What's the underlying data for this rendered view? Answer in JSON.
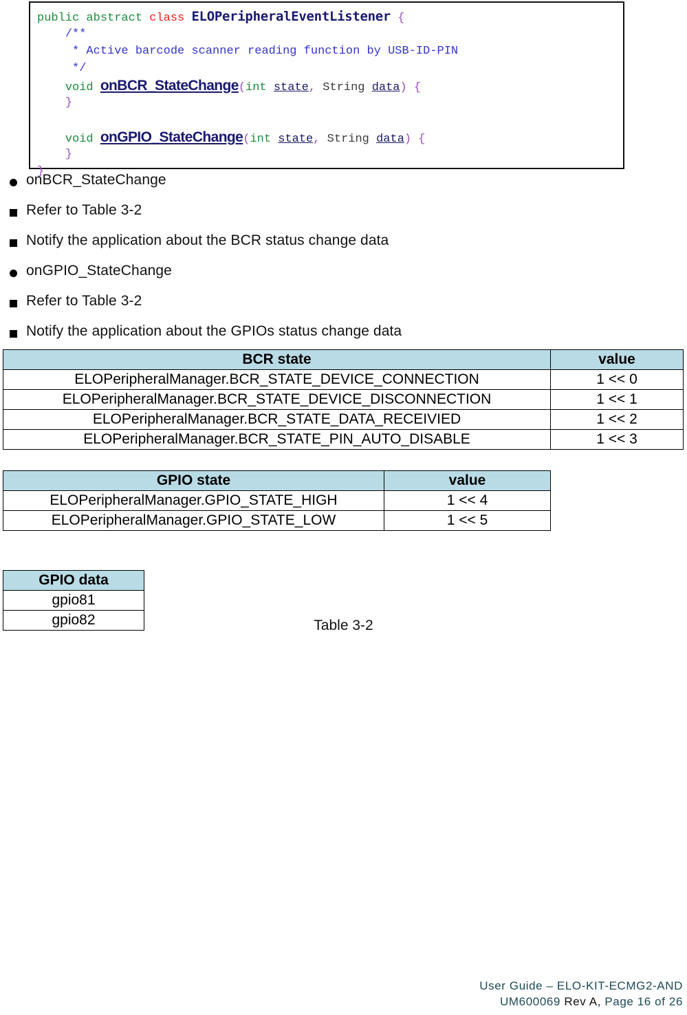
{
  "code_block": {
    "language": "java",
    "lines": [
      {
        "indent": 0,
        "tokens": [
          {
            "t": "public abstract ",
            "c": "kw-green"
          },
          {
            "t": "class ",
            "c": "kw-red"
          },
          {
            "t": "ELOPeripheralEventListener",
            "c": "cls-name"
          },
          {
            "t": " {",
            "c": "brace"
          }
        ]
      },
      {
        "indent": 1,
        "tokens": [
          {
            "t": "/**",
            "c": "cmt"
          }
        ]
      },
      {
        "indent": 1,
        "tokens": [
          {
            "t": " * Active barcode scanner reading function by USB-ID-PIN",
            "c": "cmt"
          }
        ]
      },
      {
        "indent": 1,
        "tokens": [
          {
            "t": " */",
            "c": "cmt"
          }
        ]
      },
      {
        "indent": 1,
        "tokens": [
          {
            "t": "void ",
            "c": "kw-green"
          },
          {
            "t": "onBCR_StateChange",
            "c": "method"
          },
          {
            "t": "(",
            "c": "paren"
          },
          {
            "t": "int ",
            "c": "kw-green"
          },
          {
            "t": "state",
            "c": "param"
          },
          {
            "t": ", ",
            "c": "paren"
          },
          {
            "t": "String ",
            "c": "type-dark"
          },
          {
            "t": "data",
            "c": "param"
          },
          {
            "t": ") {",
            "c": "paren"
          }
        ]
      },
      {
        "indent": 1,
        "tokens": [
          {
            "t": "}",
            "c": "brace"
          }
        ]
      },
      {
        "indent": 1,
        "tokens": [
          {
            "t": "",
            "c": "brace"
          }
        ]
      },
      {
        "indent": 1,
        "tokens": [
          {
            "t": "void ",
            "c": "kw-green"
          },
          {
            "t": "onGPIO_StateChange",
            "c": "method"
          },
          {
            "t": "(",
            "c": "paren"
          },
          {
            "t": "int ",
            "c": "kw-green"
          },
          {
            "t": "state",
            "c": "param"
          },
          {
            "t": ", ",
            "c": "paren"
          },
          {
            "t": "String ",
            "c": "type-dark"
          },
          {
            "t": "data",
            "c": "param"
          },
          {
            "t": ") {",
            "c": "paren"
          }
        ]
      },
      {
        "indent": 1,
        "tokens": [
          {
            "t": "}",
            "c": "brace"
          }
        ]
      },
      {
        "indent": 0,
        "tokens": [
          {
            "t": "}",
            "c": "brace"
          }
        ]
      }
    ]
  },
  "bullets": [
    {
      "marker": "disc",
      "text": "onBCR_StateChange"
    },
    {
      "marker": "square",
      "text": "Refer to Table 3-2"
    },
    {
      "marker": "square",
      "text": "Notify the application about the BCR status change data"
    },
    {
      "marker": "disc",
      "text": "onGPIO_StateChange"
    },
    {
      "marker": "square",
      "text": "Refer to Table 3-2"
    },
    {
      "marker": "square",
      "text": "Notify the application about the GPIOs status change data"
    }
  ],
  "bcr_table": {
    "headers": [
      "BCR state",
      "value"
    ],
    "rows": [
      [
        "ELOPeripheralManager.BCR_STATE_DEVICE_CONNECTION",
        "1 << 0"
      ],
      [
        "ELOPeripheralManager.BCR_STATE_DEVICE_DISCONNECTION",
        "1 << 1"
      ],
      [
        "ELOPeripheralManager.BCR_STATE_DATA_RECEIVIED",
        "1 << 2"
      ],
      [
        "ELOPeripheralManager.BCR_STATE_PIN_AUTO_DISABLE",
        "1 << 3"
      ]
    ]
  },
  "gpio_state_table": {
    "headers": [
      "GPIO state",
      "value"
    ],
    "rows": [
      [
        "ELOPeripheralManager.GPIO_STATE_HIGH",
        "1 << 4"
      ],
      [
        "ELOPeripheralManager.GPIO_STATE_LOW",
        "1 << 5"
      ]
    ]
  },
  "gpio_data_table": {
    "headers": [
      "GPIO data"
    ],
    "rows": [
      [
        "gpio81"
      ],
      [
        "gpio82"
      ]
    ]
  },
  "caption": "Table 3-2",
  "footer": {
    "line1": "User  Guide  –  ELO-KIT-ECMG2-AND",
    "line2_part1": "UM600069",
    "line2_rev": "Rev  A,",
    "line2_part2": "Page  16  of  26"
  },
  "colors": {
    "table_header_bg": "#b9dbe6",
    "footer_text": "#1d4a55",
    "code_keyword_green": "#1f8a3b",
    "code_keyword_red": "#e8231b",
    "code_comment_blue": "#3434cc",
    "code_identifier_navy": "#191970",
    "code_brace_purple": "#9a4fbf"
  }
}
